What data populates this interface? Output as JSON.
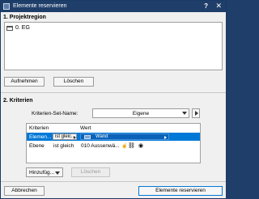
{
  "window": {
    "title": "Elemente reservieren",
    "help_label": "?",
    "close_label": "✕"
  },
  "section1": {
    "title": "1. Projektregion",
    "tree_items": [
      {
        "label": "0. EG",
        "icon": "folder-icon"
      }
    ],
    "add_label": "Aufnehmen",
    "delete_label": "Löschen"
  },
  "section2": {
    "title": "2. Kriterien",
    "set_name_label": "Kriterien-Set-Name:",
    "set_name_value": "Eigene",
    "table": {
      "headers": [
        "Kriterien",
        "Wert"
      ],
      "rows": [
        {
          "criterion": "Elemen...",
          "operator": "ist gleic...",
          "value": "Wand",
          "selected": true
        },
        {
          "criterion": "Ebene",
          "operator": "ist gleich",
          "value": "010 Aussenwä...",
          "selected": false
        }
      ]
    },
    "add_dropdown_label": "Hinzufüg...",
    "delete_label": "Löschen"
  },
  "footer": {
    "cancel_label": "Abbrechen",
    "reserve_label": "Elemente reservieren"
  },
  "colors": {
    "titlebar": "#1f3f6a",
    "selection": "#0078d7"
  }
}
